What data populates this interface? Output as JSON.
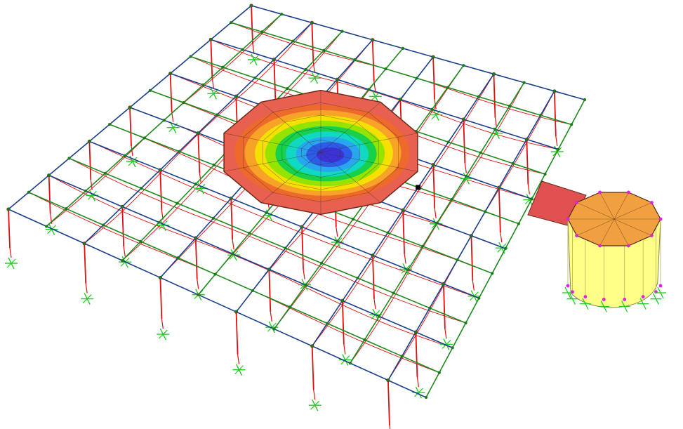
{
  "model_view": {
    "colors": {
      "background": "#ffffff",
      "beam_x": "#1a3f8c",
      "beam_y": "#1e8a1e",
      "deformed_shape": "#e01010",
      "column": "#e01010",
      "joint": "#1a7a1a",
      "column_head": "#d01010",
      "support": "#22cc22",
      "selected_joint": "#000000",
      "wall": "#ffff88",
      "wall_joint": "#e020e0",
      "contour_levels": [
        "#e86050",
        "#ee6a2a",
        "#f7a628",
        "#f5e400",
        "#8ee400",
        "#10d050",
        "#10d8c8",
        "#2aa4f0",
        "#2c58e8",
        "#3c30d8"
      ]
    },
    "icons": {
      "support": "fixed-support-icon",
      "joint": "joint-dot-icon"
    },
    "slab_segments": 10,
    "grid_size": [
      12,
      11
    ]
  }
}
